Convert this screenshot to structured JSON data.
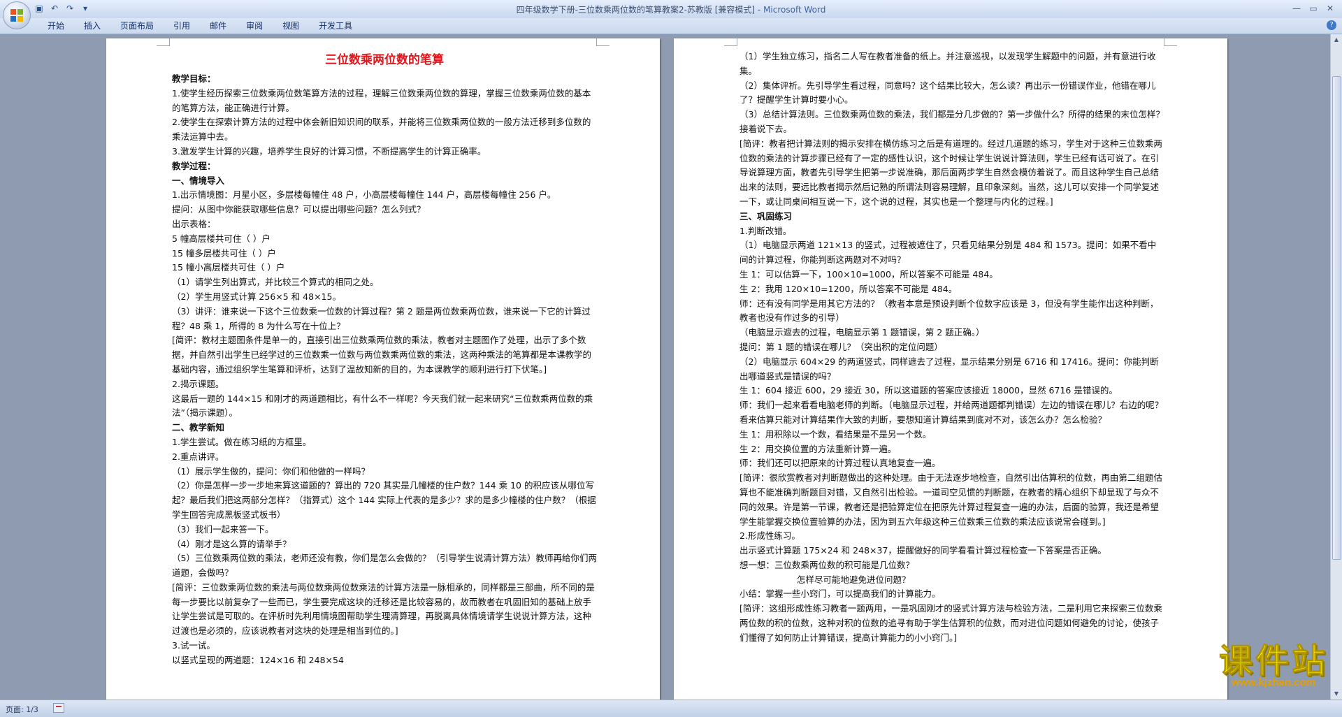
{
  "window": {
    "title": "四年级数学下册-三位数乘两位数的笔算教案2-苏教版 [兼容模式] - ",
    "app_name": "Microsoft Word",
    "controls": [
      "—",
      "▭",
      "✕"
    ]
  },
  "qat": [
    "save-icon",
    "undo-icon",
    "redo-icon",
    "customize-icon"
  ],
  "ribbon": {
    "tabs": [
      "开始",
      "插入",
      "页面布局",
      "引用",
      "邮件",
      "审阅",
      "视图",
      "开发工具"
    ],
    "help": "?"
  },
  "page1": {
    "title": "三位数乘两位数的笔算",
    "lines": [
      {
        "t": "教学目标：",
        "b": true
      },
      {
        "t": "1.使学生经历探索三位数乘两位数笔算方法的过程，理解三位数乘两位数的算理，掌握三位数乘两位数的基本的笔算方法，能正确进行计算。"
      },
      {
        "t": "2.使学生在探索计算方法的过程中体会新旧知识间的联系，并能将三位数乘两位数的一般方法迁移到多位数的乘法运算中去。"
      },
      {
        "t": "3.激发学生计算的兴趣，培养学生良好的计算习惯，不断提高学生的计算正确率。"
      },
      {
        "t": "教学过程：",
        "b": true
      },
      {
        "t": "一、情境导入",
        "b": true
      },
      {
        "t": "1.出示情境图：月星小区，多层楼每幢住 48 户，小高层楼每幢住 144 户，高层楼每幢住 256 户。"
      },
      {
        "t": "提问：从图中你能获取哪些信息？可以提出哪些问题？怎么列式？"
      },
      {
        "t": "出示表格："
      },
      {
        "t": "5 幢高层楼共可住（        ）户"
      },
      {
        "t": "15 幢多层楼共可住（        ）户"
      },
      {
        "t": "15 幢小高层楼共可住（        ）户"
      },
      {
        "t": "（1）请学生列出算式，并比较三个算式的相同之处。"
      },
      {
        "t": "（2）学生用竖式计算 256×5 和 48×15。"
      },
      {
        "t": "（3）讲评：谁来说一下这个三位数乘一位数的计算过程？第 2 题是两位数乘两位数，谁来说一下它的计算过程？48 乘 1，所得的 8 为什么写在十位上？"
      },
      {
        "t": "[简评：教材主题图条件是单一的，直接引出三位数乘两位数的乘法，教者对主题图作了处理，出示了多个数据，并自然引出学生已经学过的三位数乘一位数与两位数乘两位数的乘法，这两种乘法的笔算都是本课教学的基础内容，通过组织学生笔算和评析，达到了温故知新的目的，为本课教学的顺利进行打下伏笔。]"
      },
      {
        "t": "2.揭示课题。"
      },
      {
        "t": "这最后一题的 144×15 和刚才的两道题相比，有什么不一样呢？今天我们就一起来研究“三位数乘两位数的乘法”（揭示课题）。"
      },
      {
        "t": "二、教学新知",
        "b": true
      },
      {
        "t": "1.学生尝试。做在练习纸的方框里。"
      },
      {
        "t": "2.重点讲评。"
      },
      {
        "t": "（1）展示学生做的，提问：你们和他做的一样吗？"
      },
      {
        "t": "（2）你是怎样一步一步地来算这道题的？算出的 720 其实是几幢楼的住户数？144 乘 10 的积应该从哪位写起？最后我们把这两部分怎样？（指算式）这个 144 实际上代表的是多少？求的是多少幢楼的住户数？（根据学生回答完成黑板竖式板书）"
      },
      {
        "t": "（3）我们一起来答一下。"
      },
      {
        "t": "（4）刚才是这么算的请举手？"
      },
      {
        "t": "（5）三位数乘两位数的乘法，老师还没有教，你们是怎么会做的？（引导学生说清计算方法）教师再给你们两道题，会做吗？"
      },
      {
        "t": "[简评：三位数乘两位数的乘法与两位数乘两位数乘法的计算方法是一脉相承的，同样都是三部曲，所不同的是每一步要比以前复杂了一些而已，学生要完成这块的迁移还是比较容易的，故而教者在巩固旧知的基础上放手让学生尝试是可取的。在评析时先利用情境图帮助学生理清算理，再脱离具体情境请学生说说计算方法，这种过渡也是必须的，应该说教者对这块的处理是相当到位的。]"
      },
      {
        "t": "3.试一试。"
      },
      {
        "t": "以竖式呈现的两道题：124×16 和 248×54"
      }
    ]
  },
  "page2": {
    "lines": [
      {
        "t": "（1）学生独立练习，指名二人写在教者准备的纸上。并注意巡视，以发现学生解题中的问题，并有意进行收集。"
      },
      {
        "t": "（2）集体评析。先引导学生看过程，同意吗？这个结果比较大，怎么读？再出示一份错误作业，他错在哪儿了？提醒学生计算时要小心。"
      },
      {
        "t": "（3）总结计算法则。三位数乘两位数的乘法，我们都是分几步做的？第一步做什么？所得的结果的末位怎样？接着说下去。"
      },
      {
        "t": "[简评：教者把计算法则的揭示安排在横仿练习之后是有道理的。经过几道题的练习，学生对于这种三位数乘两位数的乘法的计算步骤已经有了一定的感性认识，这个时候让学生说说计算法则，学生已经有话可说了。在引导说算理方面，教者先引导学生把第一步说准确，那后面两步学生自然会模仿着说了。而且这种学生自己总结出来的法则，要远比教者揭示然后记熟的所谓法则容易理解，且印象深刻。当然，这儿可以安排一个同学复述一下，或让同桌间相互说一下，这个说的过程，其实也是一个整理与内化的过程。]"
      },
      {
        "t": "三、巩固练习",
        "b": true
      },
      {
        "t": "1.判断改错。"
      },
      {
        "t": "（1）电脑显示两道 121×13 的竖式，过程被遮住了，只看见结果分别是 484 和 1573。提问：如果不看中间的计算过程，你能判断这两题对不对吗？"
      },
      {
        "t": "生 1：可以估算一下，100×10=1000，所以答案不可能是 484。"
      },
      {
        "t": "生 2：我用 120×10=1200，所以答案不可能是 484。"
      },
      {
        "t": "师：还有没有同学是用其它方法的？（教者本意是预设判断个位数字应该是 3，但没有学生能作出这种判断，教者也没有作过多的引导）"
      },
      {
        "t": "（电脑显示遮去的过程，电脑显示第 1 题错误，第 2 题正确。）"
      },
      {
        "t": "提问：第 1 题的错误在哪儿？（突出积的定位问题）"
      },
      {
        "t": "（2）电脑显示 604×29 的两道竖式，同样遮去了过程，显示结果分别是 6716 和 17416。提问：你能判断出哪道竖式是错误的吗？"
      },
      {
        "t": "生 1：604 接近 600，29 接近 30，所以这道题的答案应该接近 18000，显然 6716 是错误的。"
      },
      {
        "t": "师：我们一起来看看电脑老师的判断。（电脑显示过程，并给两道题都判错误）左边的错误在哪儿？右边的呢？看来估算只能对计算结果作大致的判断，要想知道计算结果到底对不对，该怎么办？怎么检验？"
      },
      {
        "t": "生 1：用积除以一个数，看结果是不是另一个数。"
      },
      {
        "t": "生 2：用交换位置的方法重新计算一遍。"
      },
      {
        "t": "师：我们还可以把原来的计算过程认真地复查一遍。"
      },
      {
        "t": "[简评：很欣赏教者对判断题做出的这种处理。由于无法逐步地检查，自然引出估算积的位数，再由第二组题估算也不能准确判断题目对错，又自然引出检验。一道司空见惯的判断题，在教者的精心组织下却显现了与众不同的效果。许是第一节课，教者还是把验算定位在把原先计算过程复查一遍的办法，后面的验算，我还是希望学生能掌握交换位置验算的办法，因为到五六年级这种三位数乘三位数的乘法应该说常会碰到。]"
      },
      {
        "t": "2.形成性练习。"
      },
      {
        "t": "出示竖式计算题 175×24 和 248×37，提醒做好的同学看看计算过程检查一下答案是否正确。"
      },
      {
        "t": "想一想：三位数乘两位数的积可能是几位数？"
      },
      {
        "t": "怎样尽可能地避免进位问题？",
        "ind": true
      },
      {
        "t": "小结：掌握一些小窍门，可以提高我们的计算能力。"
      },
      {
        "t": "[简评：这组形成性练习教者一题两用，一是巩固刚才的竖式计算方法与检验方法，二是利用它来探索三位数乘两位数的积的位数，这种对积的位数的追寻有助于学生估算积的位数，而对进位问题如何避免的讨论，使孩子们懂得了如何防止计算错误，提高计算能力的小小窍门。]"
      }
    ]
  },
  "statusbar": {
    "pages": "页面: 1/3"
  },
  "watermark": {
    "text": "课件站",
    "url": "www.kjzhan.com"
  }
}
